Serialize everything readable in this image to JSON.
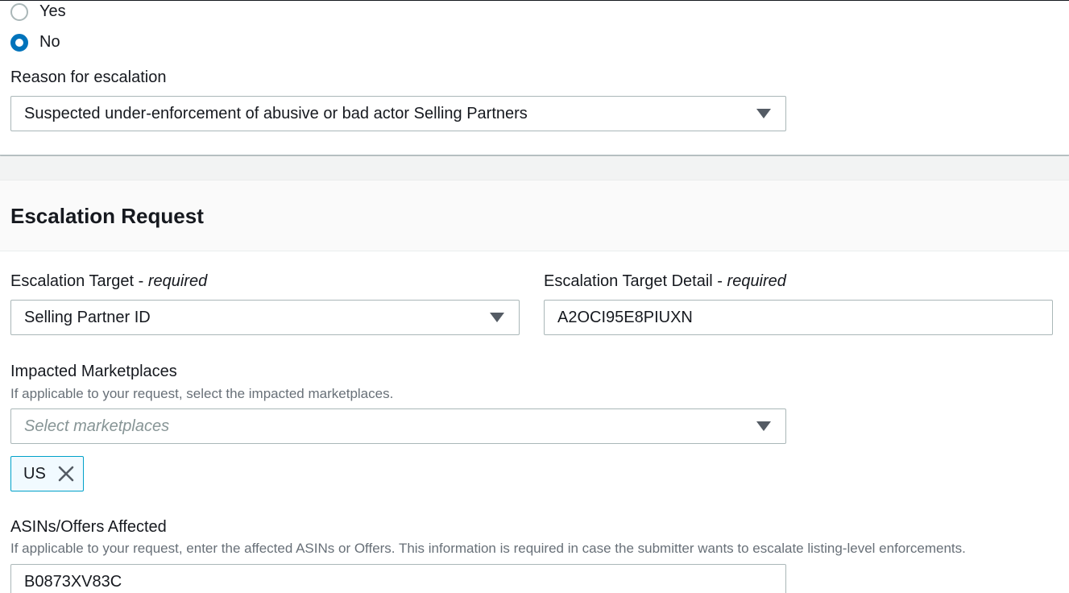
{
  "escalation_question": {
    "options": [
      {
        "label": "Yes",
        "checked": false
      },
      {
        "label": "No",
        "checked": true
      }
    ]
  },
  "reason": {
    "label": "Reason for escalation",
    "value": "Suspected under-enforcement of abusive or bad actor Selling Partners"
  },
  "section": {
    "title": "Escalation Request"
  },
  "target": {
    "label": "Escalation Target",
    "required": "required",
    "value": "Selling Partner ID"
  },
  "target_detail": {
    "label": "Escalation Target Detail",
    "required": "required",
    "value": "A2OCI95E8PIUXN"
  },
  "marketplaces": {
    "label": "Impacted Marketplaces",
    "hint": "If applicable to your request, select the impacted marketplaces.",
    "placeholder": "Select marketplaces",
    "tokens": [
      {
        "label": "US"
      }
    ]
  },
  "asins": {
    "label": "ASINs/Offers Affected",
    "hint": "If applicable to your request, enter the affected ASINs or Offers. This information is required in case the submitter wants to escalate listing-level enforcements.",
    "value": "B0873XV83C"
  },
  "colors": {
    "accent": "#0073bb",
    "token_border": "#00a1c9",
    "token_bg": "#f1faff"
  },
  "icons": {
    "caret": "caret-down-icon",
    "dismiss": "close-icon"
  }
}
